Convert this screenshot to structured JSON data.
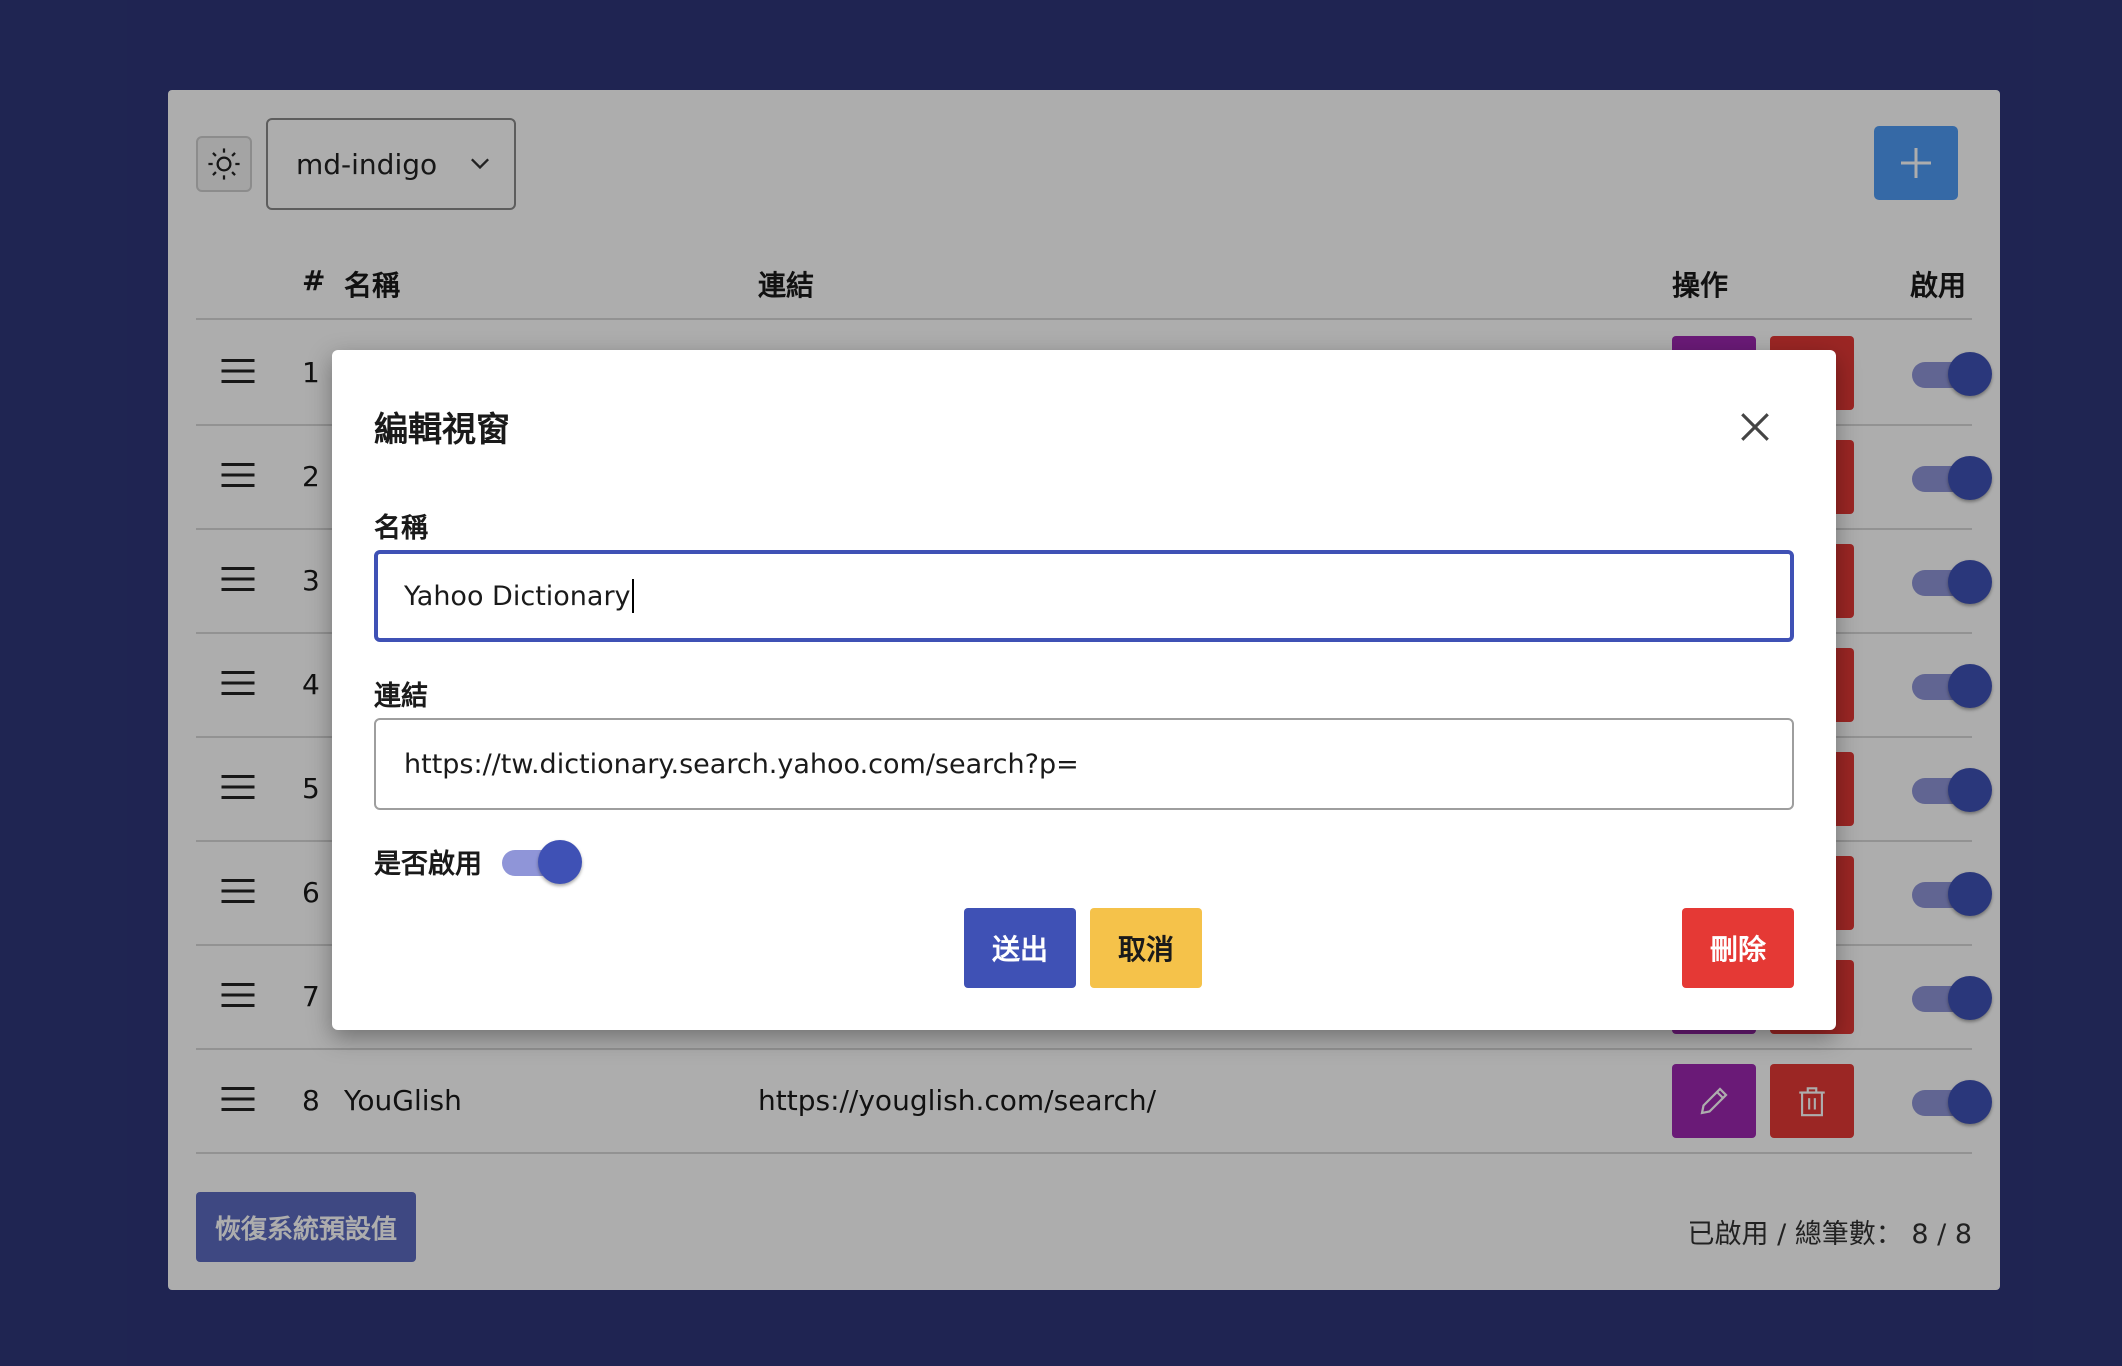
{
  "toolbar": {
    "theme_icon": "sun-icon",
    "theme_select_value": "md-indigo",
    "add_icon": "plus-icon"
  },
  "table": {
    "headers": {
      "num": "#",
      "name": "名稱",
      "url": "連結",
      "actions": "操作",
      "enabled": "啟用"
    },
    "rows": [
      {
        "num": "1",
        "name": "",
        "url": ""
      },
      {
        "num": "2",
        "name": "",
        "url": ""
      },
      {
        "num": "3",
        "name": "",
        "url": ""
      },
      {
        "num": "4",
        "name": "",
        "url": ""
      },
      {
        "num": "5",
        "name": "",
        "url": ""
      },
      {
        "num": "6",
        "name": "",
        "url": ""
      },
      {
        "num": "7",
        "name": "",
        "url": ""
      },
      {
        "num": "8",
        "name": "YouGlish",
        "url": "https://youglish.com/search/"
      }
    ]
  },
  "footer": {
    "restore_label": "恢復系統預設值",
    "stats_label": "已啟用 / 總筆數：",
    "stats_value": "8 / 8"
  },
  "modal": {
    "title": "編輯視窗",
    "name_label": "名稱",
    "name_value": "Yahoo Dictionary",
    "url_label": "連結",
    "url_value": "https://tw.dictionary.search.yahoo.com/search?p=",
    "enable_label": "是否啟用",
    "submit_label": "送出",
    "cancel_label": "取消",
    "delete_label": "刪除"
  },
  "colors": {
    "background": "#2e3679",
    "primary": "#3f51b5",
    "add_button": "#4f9bf5",
    "edit_button": "#9c27b0",
    "delete_button": "#e53935",
    "cancel_button": "#f5c24a"
  }
}
